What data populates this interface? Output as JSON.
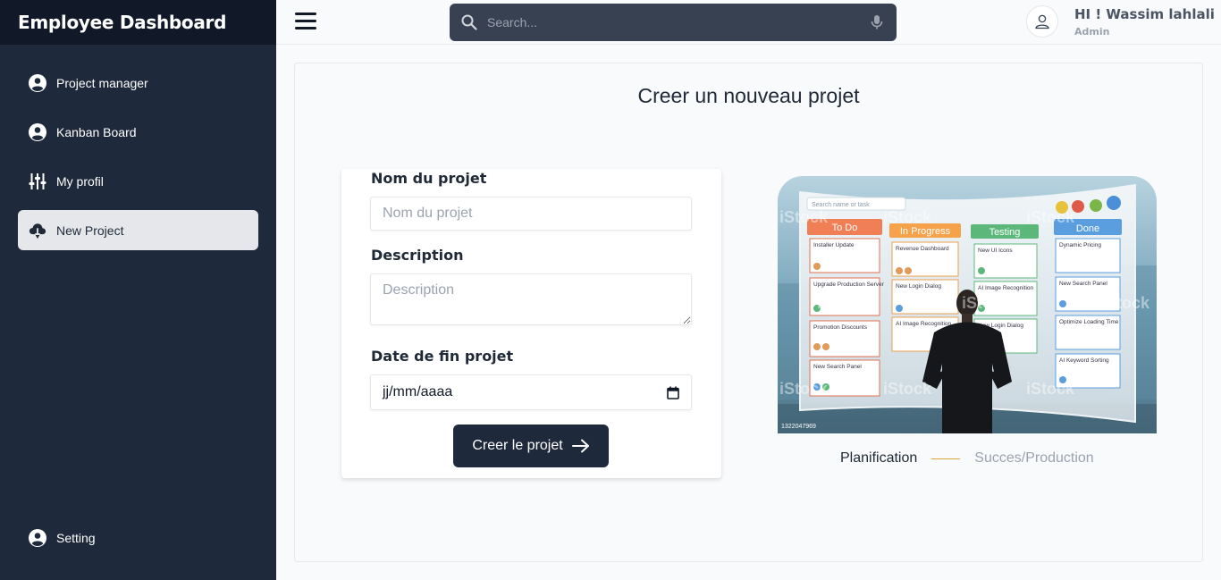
{
  "brand": {
    "title": "Employee Dashboard"
  },
  "sidebar": {
    "items": [
      {
        "label": "Project manager",
        "icon": "user-circle-icon"
      },
      {
        "label": "Kanban Board",
        "icon": "user-circle-icon"
      },
      {
        "label": "My profil",
        "icon": "sliders-icon"
      },
      {
        "label": "New Project",
        "icon": "cloud-download-icon"
      }
    ],
    "bottom_item": {
      "label": "Setting",
      "icon": "user-circle-icon"
    }
  },
  "header": {
    "search_placeholder": "Search...",
    "user_greeting": "HI ! Wassim lahlali",
    "user_role": "Admin"
  },
  "page": {
    "title": "Creer un nouveau projet",
    "form": {
      "name_label": "Nom du projet",
      "name_placeholder": "Nom du projet",
      "description_label": "Description",
      "description_placeholder": "Description",
      "date_label": "Date de fin projet",
      "date_placeholder": "jj/mm/aaaa",
      "submit_label": "Creer le projet"
    },
    "illustration": {
      "columns": [
        "To Do",
        "In Progress",
        "Testing",
        "Done"
      ],
      "search_hint": "Search name or task",
      "todo_cards": [
        "Installer Update",
        "Upgrade Production Server",
        "Promotion Discounts",
        "New Search Panel"
      ],
      "progress_cards": [
        "Revenue Dashboard",
        "New Login Dialog",
        "AI Image Recognition"
      ],
      "testing_cards": [
        "New UI Icons",
        "AI Image Recognition",
        "New Login Dialog"
      ],
      "done_cards": [
        "Dynamic Pricing",
        "New Search Panel",
        "Optimize Loading Time",
        "AI Keyword Sorting"
      ],
      "watermark": "iStock",
      "stock_id": "1322047969"
    },
    "legend": {
      "left": "Planification",
      "right": "Succes/Production"
    }
  },
  "colors": {
    "sidebar": "#1e293b",
    "brand_bar": "#111827",
    "search_bg": "#374151",
    "button": "#1e293b",
    "legend_line": "#d6a533"
  }
}
